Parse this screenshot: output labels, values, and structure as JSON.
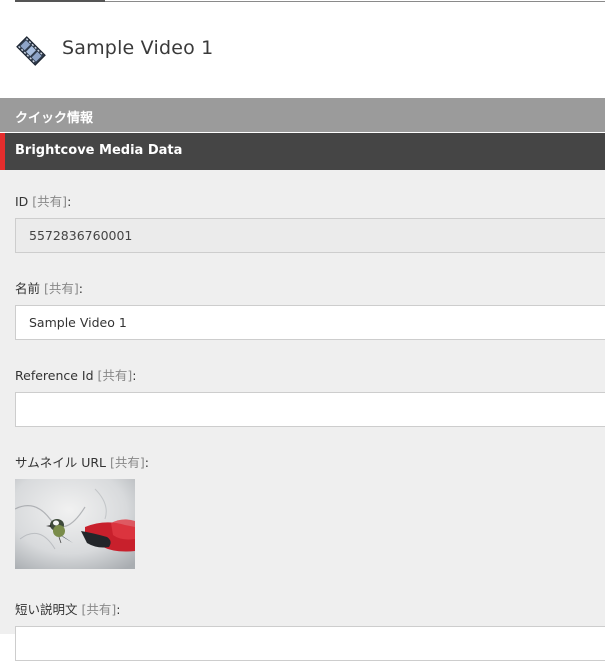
{
  "header": {
    "title": "Sample Video 1",
    "icon": "film-strip-icon"
  },
  "sections": {
    "quick_info": "クイック情報",
    "brightcove": "Brightcove Media Data"
  },
  "fields": {
    "id": {
      "label": "ID",
      "shared": "[共有]",
      "suffix": ":",
      "value": "5572836760001"
    },
    "name": {
      "label": "名前",
      "shared": "[共有]",
      "suffix": ":",
      "value": "Sample Video 1"
    },
    "reference_id": {
      "label": "Reference Id",
      "shared": "[共有]",
      "suffix": ":",
      "value": ""
    },
    "thumbnail": {
      "label": "サムネイル URL",
      "shared": "[共有]",
      "suffix": ":"
    },
    "short_description": {
      "label": "短い説明文",
      "shared": "[共有]",
      "suffix": ":",
      "value": ""
    }
  },
  "colors": {
    "accent": "#e52d2d",
    "section_dark": "#454545",
    "section_light": "#9b9b9b",
    "panel_bg": "#efefef"
  }
}
